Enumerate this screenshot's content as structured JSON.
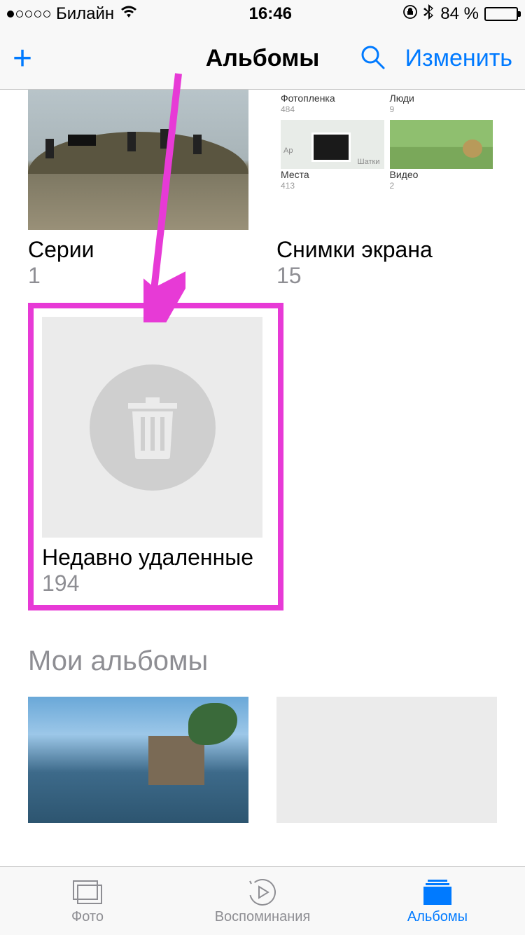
{
  "status": {
    "carrier": "Билайн",
    "time": "16:46",
    "battery_pct": "84 %"
  },
  "nav": {
    "title": "Альбомы",
    "edit": "Изменить"
  },
  "albums": {
    "row1": [
      {
        "title": "Серии",
        "count": "1"
      },
      {
        "title": "Снимки экрана",
        "count": "15"
      }
    ],
    "recently_deleted": {
      "title": "Недавно удаленные",
      "count": "194"
    },
    "screenshots_mini": {
      "top": [
        {
          "label": "Фотопленка",
          "sub": "484"
        },
        {
          "label": "Люди",
          "sub": "9"
        }
      ],
      "mid": [
        {
          "label": "Места",
          "sub": "413",
          "map_city1": "Ар",
          "map_city2": "Шатки"
        },
        {
          "label": "Видео",
          "sub": "2"
        }
      ]
    }
  },
  "section": {
    "my_albums": "Мои альбомы"
  },
  "tabs": {
    "photos": "Фото",
    "memories": "Воспоминания",
    "albums": "Альбомы"
  },
  "colors": {
    "tint": "#007aff",
    "highlight": "#e73ad6",
    "gray": "#8e8e93"
  }
}
